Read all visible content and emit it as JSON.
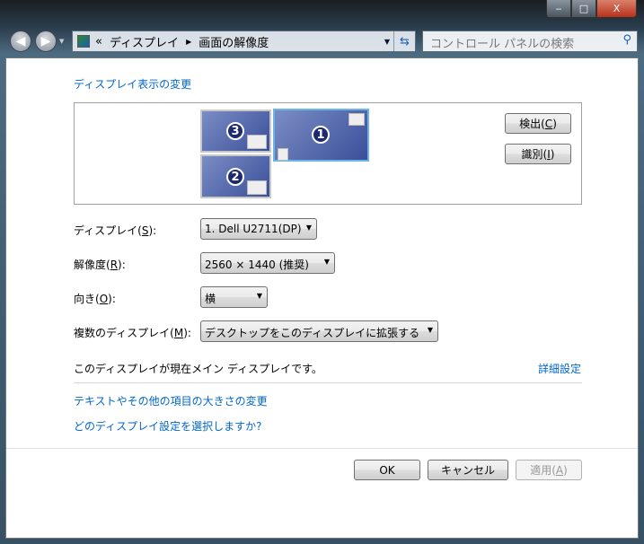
{
  "window": {
    "minimize": "‒",
    "maximize": "□",
    "close": "X"
  },
  "address": {
    "chevron": "«",
    "crumbs": [
      "ディスプレイ",
      "画面の解像度"
    ],
    "search_placeholder": "コントロール パネルの検索"
  },
  "main": {
    "heading": "ディスプレイ表示の変更",
    "monitors": [
      {
        "number": "1"
      },
      {
        "number": "2"
      },
      {
        "number": "3"
      }
    ],
    "detect": {
      "label": "検出(",
      "key": "C",
      "end": ")"
    },
    "identify": {
      "label": "識別(",
      "key": "I",
      "end": ")"
    },
    "rows": [
      {
        "label": "ディスプレイ(",
        "key": "S",
        "end": "):",
        "value": "1. Dell U2711(DP)"
      },
      {
        "label": "解像度(",
        "key": "R",
        "end": "):",
        "value": "2560 × 1440 (推奨)"
      },
      {
        "label": "向き(",
        "key": "O",
        "end": "):",
        "value": "横"
      },
      {
        "label": "複数のディスプレイ(",
        "key": "M",
        "end": "):",
        "value": "デスクトップをこのディスプレイに拡張する"
      }
    ],
    "status": "このディスプレイが現在メイン ディスプレイです。",
    "advanced": "詳細設定",
    "links": [
      "テキストやその他の項目の大きさの変更",
      "どのディスプレイ設定を選択しますか?"
    ]
  },
  "footer": {
    "ok": "OK",
    "cancel": "キャンセル",
    "apply": "適用(",
    "apply_key": "A",
    "apply_end": ")"
  }
}
